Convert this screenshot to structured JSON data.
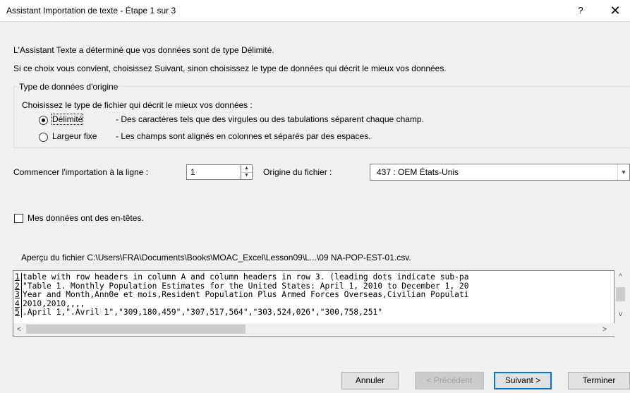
{
  "window": {
    "title": "Assistant Importation de texte - Étape 1 sur 3",
    "help_label": "?",
    "close_label": "✕"
  },
  "intro": {
    "line1": "L'Assistant Texte a déterminé que vos données sont de type Délimité.",
    "line2": "Si ce choix vous convient, choisissez Suivant, sinon choisissez le type de données qui décrit le mieux vos données."
  },
  "data_type_group": {
    "legend": "Type de données d'origine",
    "prompt": "Choisissez le type de fichier qui décrit le mieux vos données :",
    "options": [
      {
        "label": "Délimité",
        "description": "- Des caractères tels que des virgules ou des tabulations séparent chaque champ.",
        "selected": true
      },
      {
        "label": "Largeur fixe",
        "description": "- Les champs sont alignés en colonnes et séparés par des espaces.",
        "selected": false
      }
    ]
  },
  "start_row": {
    "label": "Commencer l'importation à la ligne :",
    "value": "1"
  },
  "file_origin": {
    "label": "Origine du fichier :",
    "value": "437 : OEM États-Unis"
  },
  "headers_checkbox": {
    "label": "Mes données ont des en-têtes.",
    "checked": false
  },
  "preview": {
    "label": "Aperçu du fichier C:\\Users\\FRA\\Documents\\Books\\MOAC_Excel\\Lesson09\\L...\\09 NA-POP-EST-01.csv.",
    "rows": [
      {
        "num": "1",
        "text": "table with row headers in column A and column headers in row 3. (leading dots indicate sub-pa"
      },
      {
        "num": "2",
        "text": "\"Table 1. Monthly Population Estimates for the United States: April 1, 2010 to December 1, 20"
      },
      {
        "num": "3",
        "text": "Year and Month,AnnΘe et mois,Resident Population Plus Armed Forces Overseas,Civilian Populati"
      },
      {
        "num": "4",
        "text": "2010,2010,,,,"
      },
      {
        "num": "5",
        "text": ".April 1,\".Avril 1\",\"309,180,459\",\"307,517,564\",\"303,524,026\",\"300,758,251\""
      }
    ]
  },
  "buttons": {
    "cancel": "Annuler",
    "previous": "< Précédent",
    "next": "Suivant >",
    "finish": "Terminer"
  },
  "icons": {
    "spin_up": "spin-up-icon",
    "spin_down": "spin-down-icon",
    "dropdown": "chevron-down-icon",
    "scroll_up": "scroll-up-icon",
    "scroll_down": "scroll-down-icon",
    "scroll_left": "scroll-left-icon",
    "scroll_right": "scroll-right-icon"
  },
  "colors": {
    "default_button_border": "#0078d7",
    "dialog_background": "#f0f0f0"
  }
}
